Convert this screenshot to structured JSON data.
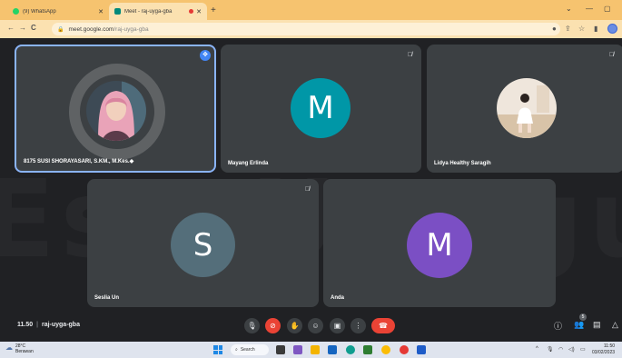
{
  "browser": {
    "tabs": [
      {
        "label": "(9) WhatsApp",
        "favicon_color": "#25d366"
      },
      {
        "label": "Meet - raj-uyga-gba",
        "favicon_color": "#00897b",
        "recording": true
      }
    ],
    "new_tab_symbol": "+",
    "url_host": "meet.google.com",
    "url_path": "/raj-uyga-gba",
    "accent": "#f6c36f"
  },
  "meet": {
    "watermark": "Esa Unggul",
    "tiles": [
      {
        "name": "8175 SUSI SHORAYASARI, S.KM., M.Kes.◆",
        "kind": "photo-hijab",
        "active": true,
        "pinned": true
      },
      {
        "name": "Mayang Erlinda",
        "initial": "M",
        "avatar_color": "#0097a7",
        "muted": true
      },
      {
        "name": "Lidya Healthy Saragih",
        "kind": "photo-room",
        "muted": true
      },
      {
        "name": "Seslia Un",
        "initial": "S",
        "avatar_color": "#546e7a",
        "muted": true
      },
      {
        "name": "Anda",
        "initial": "M",
        "avatar_color": "#7b4fc4"
      }
    ],
    "time": "11.50",
    "meeting_code": "raj-uyga-gba",
    "participant_count": "5"
  },
  "taskbar": {
    "temperature": "28°C",
    "weather_text": "Berawan",
    "search_label": "Search",
    "time": "11:50",
    "date": "03/02/2023"
  }
}
